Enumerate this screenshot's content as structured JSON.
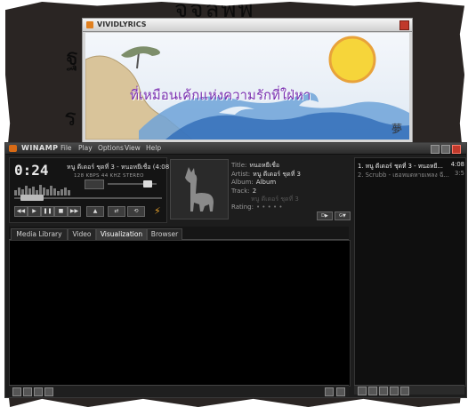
{
  "background": {
    "deco_top": "จจลพพ",
    "deco_left": "ฐ",
    "deco_mid": "ร"
  },
  "lyrics_window": {
    "title": "VIVIDLYRICS",
    "lyric_line": "ที่เหมือนเค้กแห่งความรักที่ใฝ่หา",
    "signature": "夢"
  },
  "winamp": {
    "title": "WINAMP",
    "menu": [
      "File",
      "Play",
      "Options",
      "View",
      "Help"
    ],
    "player": {
      "time": "0:24",
      "song": "หนู ดีเดอร์ ชุดที่ 3 - หนอหยีเชื่อ (4:08)",
      "kbps": "128 KBPS",
      "khz": "44 KHZ",
      "stereo": "STEREO",
      "controls": [
        "◀◀",
        "▶",
        "❚❚",
        "■",
        "▶▶"
      ],
      "eject": "▲"
    },
    "metadata": {
      "title_label": "Title:",
      "title_value": "หนอหยีเชื่อ",
      "artist_label": "Artist:",
      "artist_value": "หนู ดีเดอร์ ชุดที่ 3",
      "album_label": "Album:",
      "album_value": "Album",
      "track_label": "Track:",
      "track_value": "2",
      "genre_text": "หนู ดีเดอร์ ชุดที่ 3",
      "rating_label": "Rating:",
      "rating_value": "• • • • •",
      "btn1": "D▶",
      "btn2": "G▼"
    },
    "tabs": [
      "Media Library",
      "Video",
      "Visualization",
      "Browser"
    ],
    "active_tab": "Visualization",
    "playlist": {
      "items": [
        {
          "label": "1. หนู ดีเดอร์ ชุดที่ 3 - หนอหยี...",
          "duration": "4:08"
        },
        {
          "label": "2. Scrubb - เธอหมดหายเพลง ฉี...",
          "duration": "3:5"
        }
      ]
    }
  }
}
